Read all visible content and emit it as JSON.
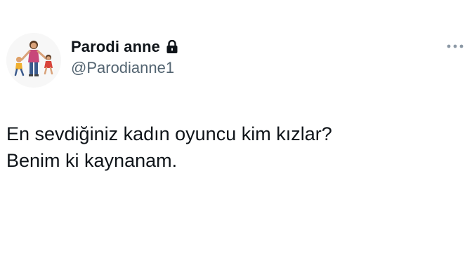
{
  "tweet": {
    "author": {
      "display_name": "Parodi anne",
      "username": "@Parodianne1",
      "protected_icon": "lock-icon",
      "avatar_icon": "mother-with-children-avatar"
    },
    "text_lines": [
      "En sevdiğiniz kadın oyuncu kim kızlar?",
      "Benim ki kaynanam."
    ],
    "more_icon": "more-horizontal-icon"
  },
  "colors": {
    "text_primary": "#0f1419",
    "text_secondary": "#536471",
    "background": "#ffffff",
    "avatar_background": "#f7f7f7"
  }
}
